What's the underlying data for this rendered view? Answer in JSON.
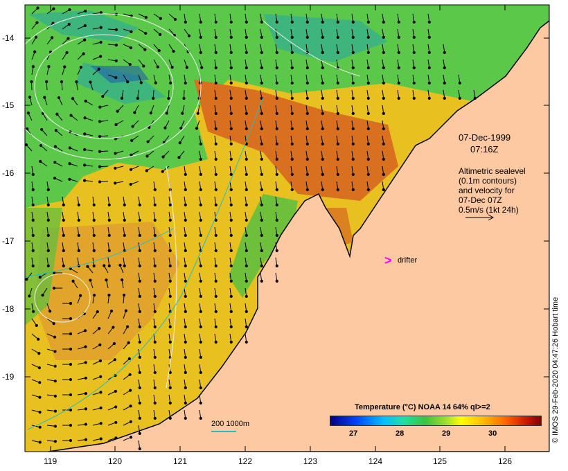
{
  "map": {
    "date": "07-Dec-1999",
    "time": "07:16Z",
    "legend_lines": [
      "Altimetric sealevel",
      "(0.1m contours)",
      "and velocity for",
      "07-Dec 07Z",
      "0.5m/s (1kt 24h)"
    ],
    "drifter_label": "drifter",
    "credit": "© IMOS 29-Feb-2020 04:47:26 Hobart time",
    "colorbar_title": "Temperature (°C) NOAA 14 64% ql>=2",
    "colorbar_ticks": [
      "27",
      "28",
      "29",
      "30"
    ],
    "scale_label": "200  1000m",
    "lat_labels": [
      "-14",
      "-15",
      "-16",
      "-17",
      "-18",
      "-19"
    ],
    "lon_labels": [
      "119",
      "120",
      "121",
      "122",
      "123",
      "124",
      "125",
      "126"
    ],
    "colors": {
      "land": "#fcc9a3",
      "drifter": "#ff00ff",
      "isobath": "#20c0c0",
      "contour": "#f0f0f0"
    }
  }
}
